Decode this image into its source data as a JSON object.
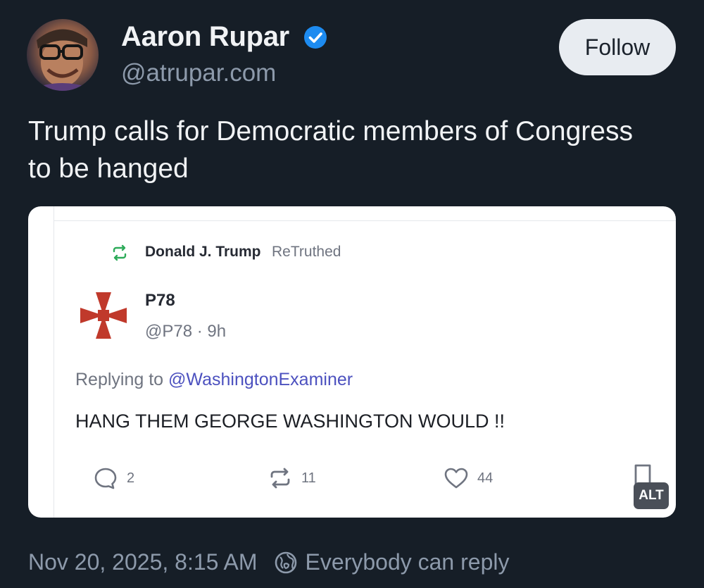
{
  "author": {
    "name": "Aaron Rupar",
    "handle": "@atrupar.com",
    "verified": true
  },
  "follow_label": "Follow",
  "post_text": "Trump calls for Democratic members of Congress to be hanged",
  "embed": {
    "retruth_name": "Donald J. Trump",
    "retruth_label": "ReTruthed",
    "poster_name": "P78",
    "poster_handle_time": "@P78 · 9h",
    "replying_prefix": "Replying to ",
    "replying_mention": "@WashingtonExaminer",
    "body": "HANG THEM GEORGE WASHINGTON WOULD !!",
    "replies": "2",
    "retruths": "11",
    "likes": "44",
    "alt_label": "ALT"
  },
  "footer": {
    "timestamp": "Nov 20, 2025, 8:15 AM",
    "reply_setting": "Everybody can reply"
  },
  "colors": {
    "background": "#161e27",
    "verified_blue": "#1d8bf0",
    "retruth_green": "#2eab5a",
    "cross_red": "#c0392b",
    "mention_purple": "#4c51bf"
  }
}
